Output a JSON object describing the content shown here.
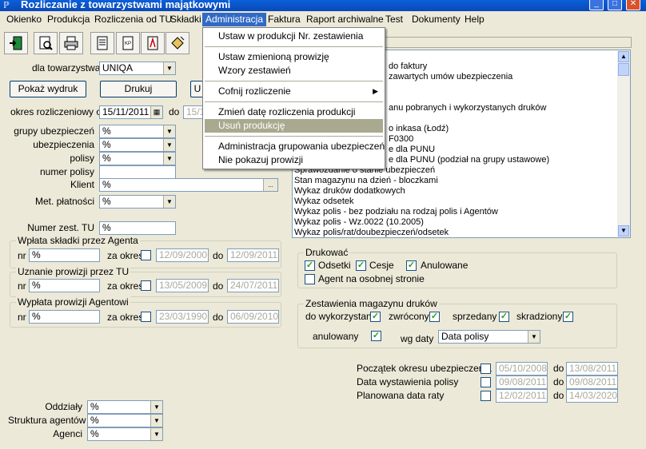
{
  "window": {
    "title": "Rozliczanie z towarzystwami majątkowymi"
  },
  "menu": [
    "Okienko",
    "Produkcja",
    "Rozliczenia od TU",
    "Składki",
    "Administracja",
    "Faktura",
    "Raport archiwalne",
    "Test",
    "Dokumenty",
    "Help"
  ],
  "dropdown": {
    "items": [
      "Ustaw w produkcji Nr. zestawienia",
      "Ustaw zmienioną prowizję",
      "Wzory zestawień",
      "Cofnij rozliczenie",
      "Zmień datę rozliczenia produkcji",
      "Usuń produkcję",
      "Administracja grupowania ubezpieczeń",
      "Nie pokazuj prowizji"
    ]
  },
  "form": {
    "towarzystwa_label": "dla towarzystwa",
    "towarzystwa_value": "UNIQA",
    "pokaz_button": "Pokaż wydruk",
    "drukuj_button": "Drukuj",
    "u_button": "U",
    "okres_label": "okres rozliczeniowy od",
    "okres_od": "15/11/2011",
    "do_label": "do",
    "okres_do": "15/1",
    "grupy_label": "grupy ubezpieczeń",
    "ubezpieczenia_label": "ubezpieczenia",
    "polisy_label": "polisy",
    "numer_polisy_label": "numer polisy",
    "klient_label": "Klient",
    "met_platnosci_label": "Met. płatności",
    "numer_zest_label": "Numer zest. TU",
    "wildcard": "%",
    "ellipsis": "..."
  },
  "groups": {
    "wplata": {
      "title": "Wpłata składki przez Agenta",
      "nr_label": "nr",
      "nr_value": "%",
      "za_okres_label": "za okres",
      "od": "12/09/2000",
      "do_label": "do",
      "do": "12/09/2011"
    },
    "uznanie": {
      "title": "Uznanie prowizji przez TU",
      "nr_label": "nr",
      "nr_value": "%",
      "za_okres_label": "za okres",
      "od": "13/05/2009",
      "do_label": "do",
      "do": "24/07/2011"
    },
    "wyplata": {
      "title": "Wypłata prowizji Agentowi",
      "nr_label": "nr",
      "nr_value": "%",
      "za_okres_label": "za okres",
      "od": "23/03/1990",
      "do_label": "do",
      "do": "06/09/2010"
    }
  },
  "reports": [
    "do faktury",
    "zawartych umów ubezpieczenia",
    "",
    "",
    "anu pobranych i wykorzystanych druków",
    "",
    "o inkasa (Łodź)",
    "F0300",
    "e dla PUNU",
    "e dla PUNU (podział na grupy ustawowe)",
    "Sprawozdanie o stanie ubezpieczeń",
    "Stan magazynu na dzień - bloczkami",
    "Wykaz druków dodatkowych",
    "Wykaz odsetek",
    "Wykaz polis - bez podziału na rodzaj polis i Agentów",
    "Wykaz polis - Wz.0022 (10.2005)",
    "Wykaz polis/rat/doubezpieczeń/odsetek"
  ],
  "drukowac": {
    "title": "Drukować",
    "odsetki": "Odsetki",
    "cesje": "Cesje",
    "anulowane": "Anulowane",
    "agent": "Agent na osobnej stronie"
  },
  "magazyn": {
    "title": "Zestawienia magazynu druków",
    "do_wykorzystania": "do wykorzystania",
    "zwrocony": "zwrócony",
    "sprzedany": "sprzedany",
    "skradziony": "skradziony",
    "anulowany": "anulowany",
    "wg_daty_label": "wg daty",
    "wg_daty_value": "Data polisy"
  },
  "dates": {
    "poczatek_label": "Początek okresu ubezpieczenia",
    "poczatek_od": "05/10/2008",
    "poczatek_do": "13/08/2011",
    "wystawienia_label": "Data wystawienia polisy",
    "wystawienia_od": "09/08/2011",
    "wystawienia_do": "09/08/2011",
    "planowana_label": "Planowana data raty",
    "planowana_od": "12/02/2011",
    "planowana_do": "14/03/2020",
    "do_label": "do"
  },
  "bottom": {
    "oddzialy_label": "Oddziały",
    "struktura_label": "Struktura agentów",
    "agenci_label": "Agenci"
  }
}
